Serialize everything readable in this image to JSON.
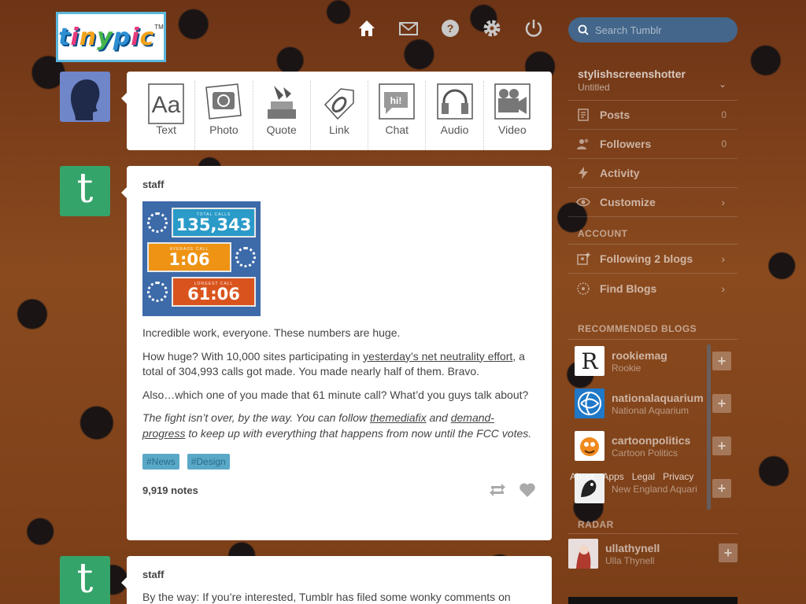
{
  "logo": {
    "text_parts": [
      "t",
      "i",
      "n",
      "y",
      "p",
      "i",
      "c"
    ],
    "tm": "TM"
  },
  "nav": {
    "icons": [
      "home-icon",
      "mail-icon",
      "help-icon",
      "gear-icon",
      "power-icon"
    ]
  },
  "search": {
    "placeholder": "Search Tumblr",
    "value": ""
  },
  "composer": {
    "types": [
      {
        "label": "Text",
        "icon": "text-icon"
      },
      {
        "label": "Photo",
        "icon": "camera-icon"
      },
      {
        "label": "Quote",
        "icon": "quote-icon"
      },
      {
        "label": "Link",
        "icon": "link-icon"
      },
      {
        "label": "Chat",
        "icon": "chat-icon"
      },
      {
        "label": "Audio",
        "icon": "headphones-icon"
      },
      {
        "label": "Video",
        "icon": "video-camera-icon"
      }
    ]
  },
  "post1": {
    "author": "staff",
    "image": {
      "total_label": "TOTAL CALLS",
      "total_value": "135,343",
      "average_label": "AVERAGE CALL",
      "average_value": "1:06",
      "longest_label": "LONGEST CALL",
      "longest_value": "61:06"
    },
    "p1": "Incredible work, everyone. These numbers are huge.",
    "p2_before": "How huge? With 10,000 sites participating in ",
    "p2_link": "yesterday’s net neutrality effort",
    "p2_after": ", a total of 304,993 calls got made. You made nearly half of them. Bravo.",
    "p3": "Also…which one of you made that 61 minute call? What’d you guys talk about?",
    "p4_before": "The fight isn’t over, by the way. You can follow ",
    "p4_link1": "themediafix",
    "p4_mid": " and ",
    "p4_link2": "demand-progress",
    "p4_after": " to keep up with everything that happens from now until the FCC votes.",
    "tags": [
      "#News",
      "#Design"
    ],
    "notes": "9,919 notes"
  },
  "post2": {
    "author": "staff",
    "p1": "By the way: If you’re interested, Tumblr has filed some wonky comments on"
  },
  "sidebar": {
    "blog_name": "stylishscreenshotter",
    "blog_title": "Untitled",
    "items": [
      {
        "label": "Posts",
        "count": "0",
        "icon": "posts-icon"
      },
      {
        "label": "Followers",
        "count": "0",
        "icon": "followers-icon"
      },
      {
        "label": "Activity",
        "count": "",
        "icon": "lightning-icon"
      },
      {
        "label": "Customize",
        "count": "",
        "icon": "eye-icon"
      }
    ],
    "account_title": "ACCOUNT",
    "account_items": [
      {
        "label": "Following 2 blogs",
        "icon": "following-icon"
      },
      {
        "label": "Find Blogs",
        "icon": "compass-icon"
      }
    ],
    "recommended_title": "RECOMMENDED BLOGS",
    "recommended": [
      {
        "name": "rookiemag",
        "sub": "Rookie"
      },
      {
        "name": "nationalaquarium",
        "sub": "National Aquarium"
      },
      {
        "name": "cartoonpolitics",
        "sub": "Cartoon Politics"
      },
      {
        "name": "",
        "sub": "New England Aquari"
      }
    ],
    "footer_links": [
      "About",
      "Apps",
      "Legal",
      "Privacy"
    ],
    "radar_title": "RADAR",
    "radar": {
      "name": "ullathynell",
      "sub": "Ulla Thynell"
    }
  }
}
